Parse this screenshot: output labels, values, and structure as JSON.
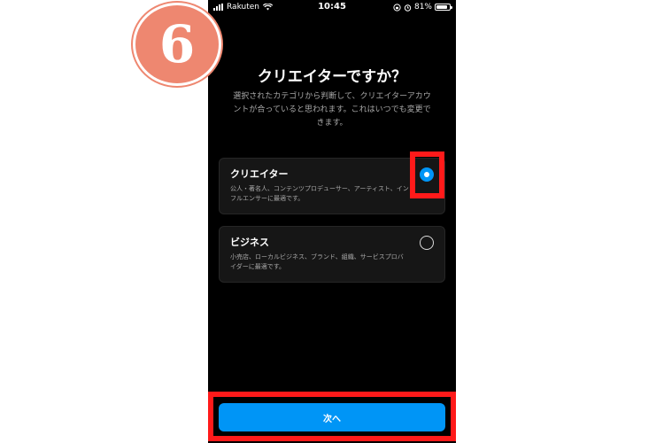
{
  "step_badge": {
    "number": "6"
  },
  "status_bar": {
    "carrier": "Rakuten",
    "time": "10:45",
    "battery": "81%"
  },
  "screen": {
    "title": "クリエイターですか？",
    "description": "選択されたカテゴリから判断して、クリエイターアカウントが合っていると思われます。これはいつでも変更できます。"
  },
  "options": [
    {
      "label": "クリエイター",
      "description": "公人・著名人、コンテンツプロデューサー、アーティスト、インフルエンサーに最適です。",
      "selected": true
    },
    {
      "label": "ビジネス",
      "description": "小売店、ローカルビジネス、ブランド、組織、サービスプロバイダーに最適です。",
      "selected": false
    }
  ],
  "next_button": {
    "label": "次へ"
  },
  "colors": {
    "accent": "#0095f6",
    "highlight": "#ff1a1a",
    "badge": "#ee8770",
    "background": "#000000"
  }
}
